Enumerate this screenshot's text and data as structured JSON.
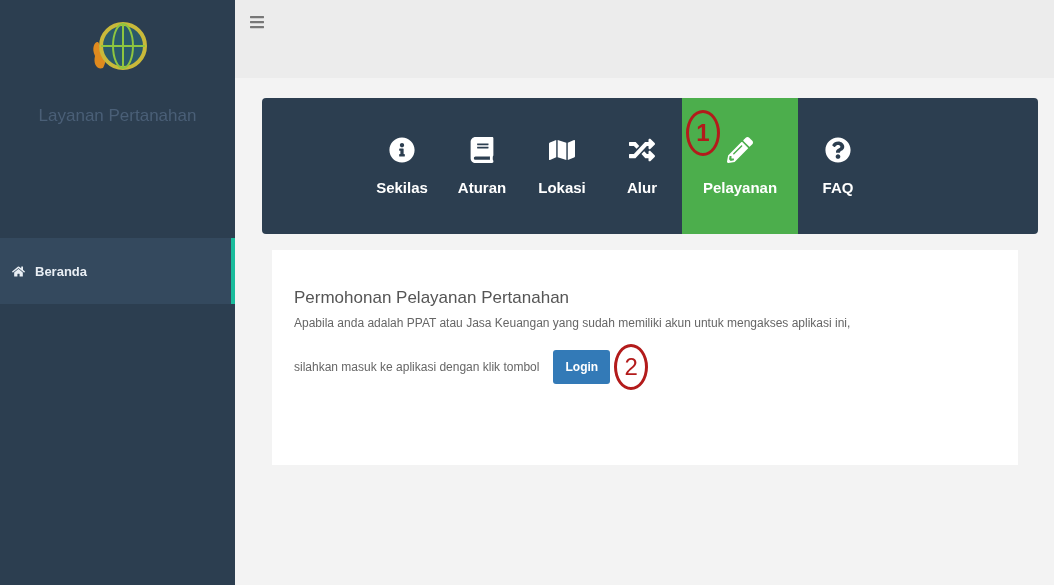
{
  "sidebar": {
    "app_name": "Layanan Pertanahan",
    "items": [
      {
        "label": "Beranda",
        "selected": true
      }
    ]
  },
  "nav_tabs": [
    {
      "label": "Sekilas",
      "selected": false
    },
    {
      "label": "Aturan",
      "selected": false
    },
    {
      "label": "Lokasi",
      "selected": false
    },
    {
      "label": "Alur",
      "selected": false
    },
    {
      "label": "Pelayanan",
      "selected": true,
      "marker": "1"
    },
    {
      "label": "FAQ",
      "selected": false
    }
  ],
  "card": {
    "title": "Permohonan Pelayanan Pertanahan",
    "text": "Apabila anda adalah PPAT atau Jasa Keuangan yang sudah memiliki akun untuk mengakses aplikasi ini,",
    "prompt": "silahkan masuk ke aplikasi dengan klik tombol",
    "button": {
      "label": "Login",
      "marker": "2"
    }
  }
}
